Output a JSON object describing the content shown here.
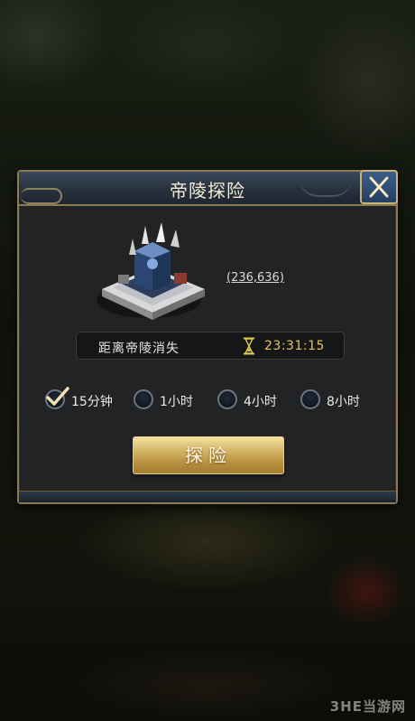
{
  "dialog": {
    "title": "帝陵探险",
    "close_icon": "close-icon",
    "coordinates": "(236,636)",
    "timer": {
      "label": "距离帝陵消失",
      "icon": "hourglass-icon",
      "value": "23:31:15"
    },
    "options": [
      {
        "label": "15分钟",
        "checked": true
      },
      {
        "label": "1小时",
        "checked": false
      },
      {
        "label": "4小时",
        "checked": false
      },
      {
        "label": "8小时",
        "checked": false
      }
    ],
    "explore_button": "探险"
  },
  "watermark": "3HE当游网",
  "colors": {
    "gold_border": "#8c7a52",
    "timer_value": "#e3c455",
    "button_gold": "#d6b86a",
    "close_blue": "#3c5e8a"
  }
}
